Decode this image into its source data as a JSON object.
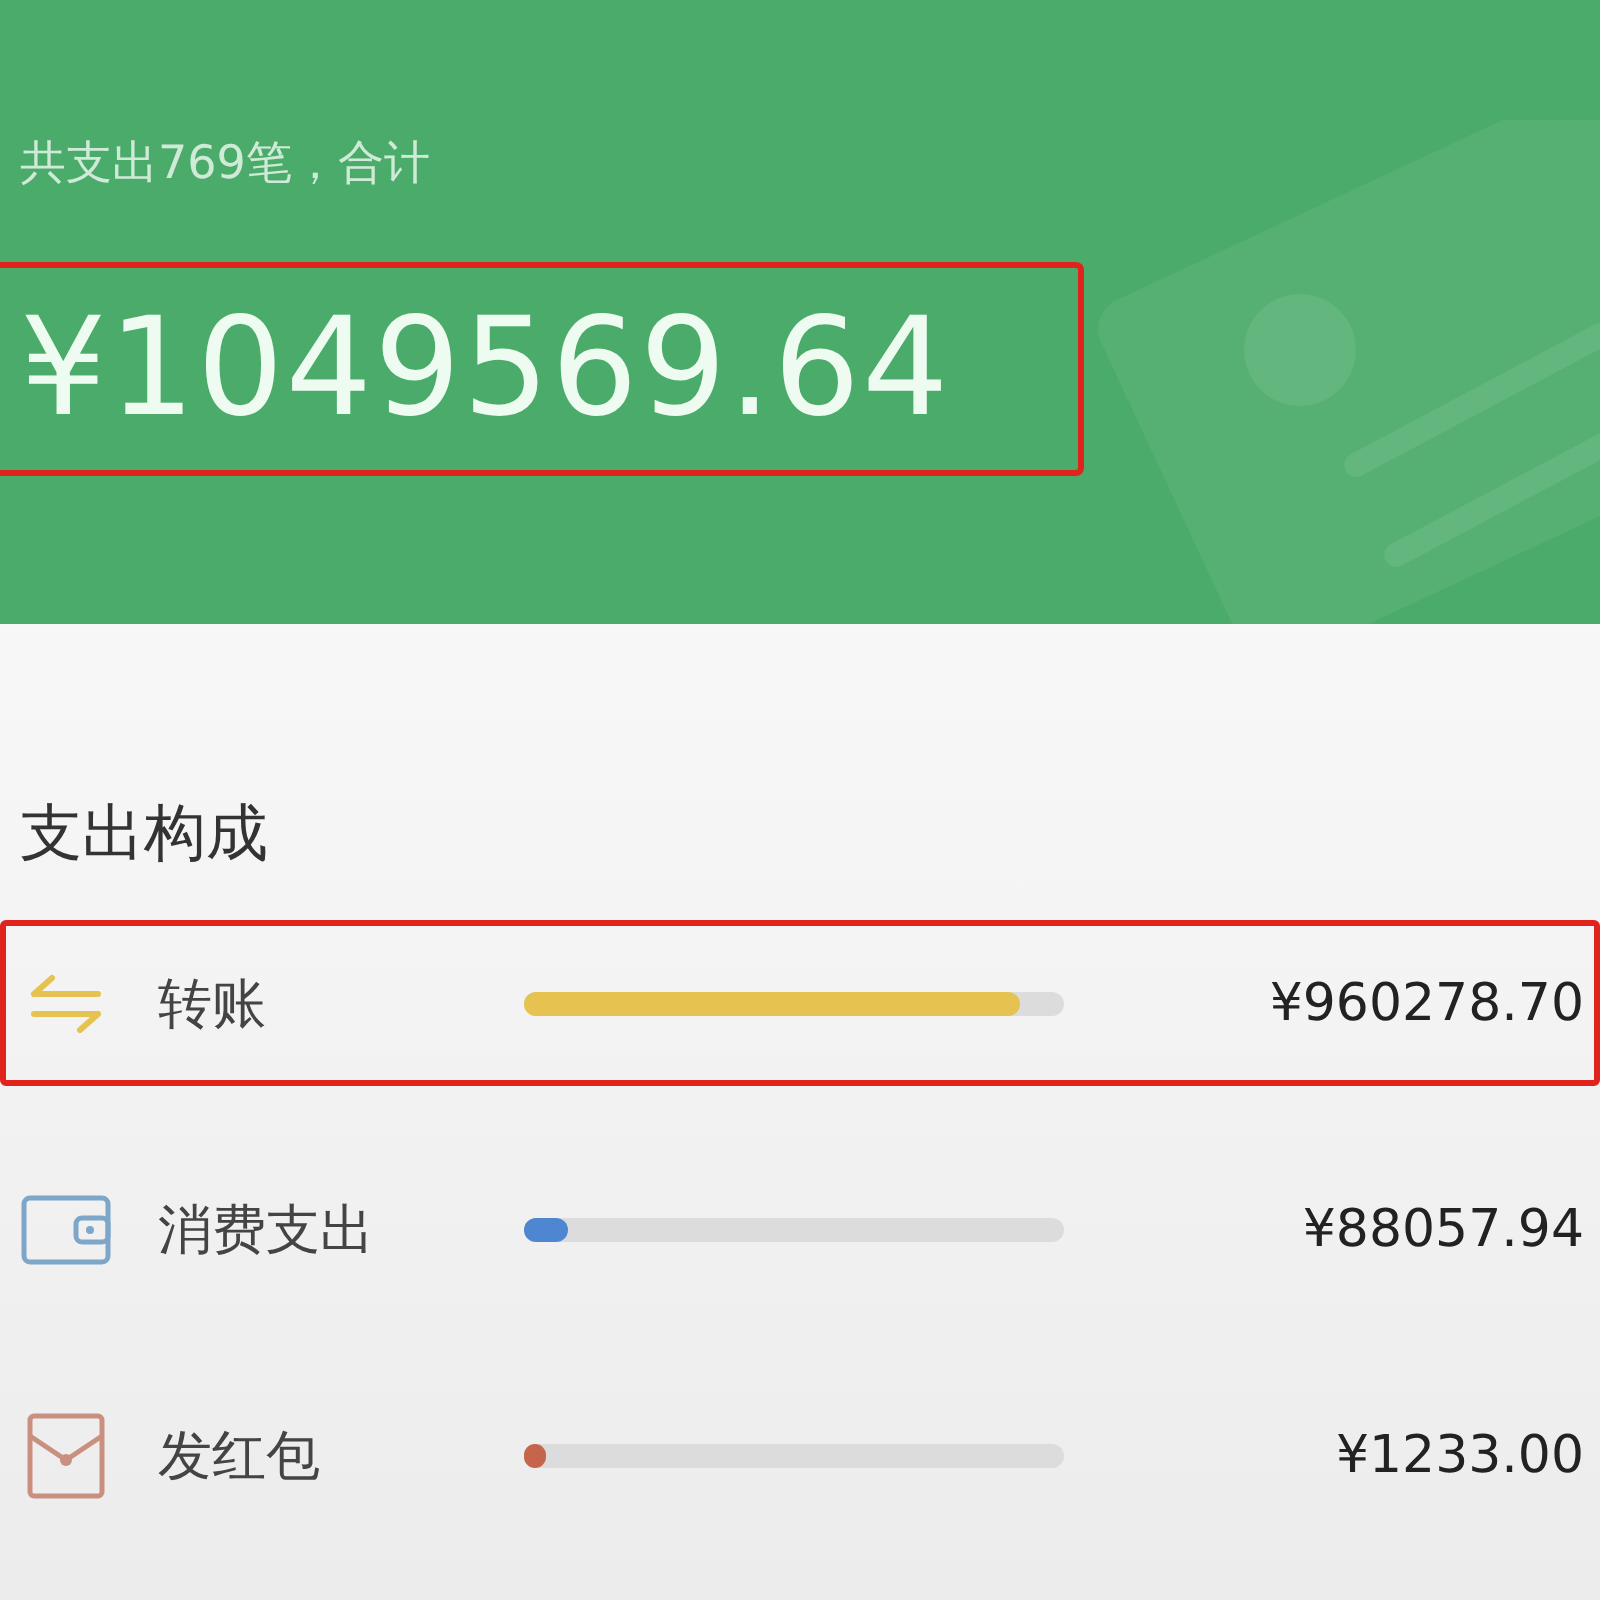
{
  "summary": {
    "caption": "共支出769笔，合计",
    "total": "¥1049569.64",
    "highlighted": true
  },
  "section_title": "支出构成",
  "categories": [
    {
      "kind": "transfer",
      "label": "转账",
      "level": 0.92,
      "color": "#e6c350",
      "amount": "¥960278.70",
      "highlighted": true
    },
    {
      "kind": "wallet",
      "label": "消费支出",
      "level": 0.08,
      "color": "#4f86d2",
      "amount": "¥88057.94",
      "highlighted": false
    },
    {
      "kind": "red-packet",
      "label": "发红包",
      "level": 0.03,
      "color": "#c4654c",
      "amount": "¥1233.00",
      "highlighted": false
    }
  ]
}
